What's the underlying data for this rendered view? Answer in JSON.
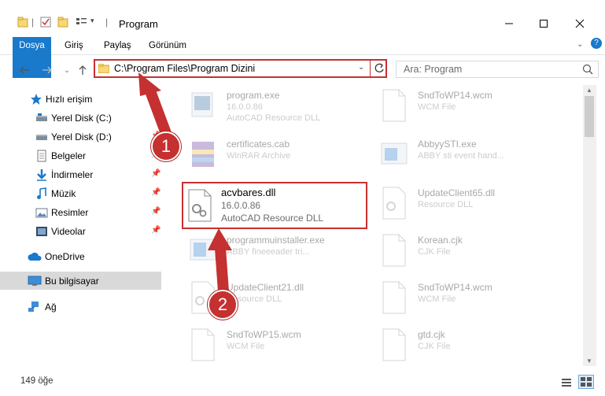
{
  "window": {
    "title": "Program",
    "minimize_icon": "minimize-icon",
    "maximize_icon": "maximize-icon",
    "close_icon": "close-icon"
  },
  "ribbon": {
    "tabs": [
      "Dosya",
      "Giriş",
      "Paylaş",
      "Görünüm"
    ]
  },
  "address": {
    "path": "C:\\Program Files\\Program Dizini"
  },
  "search": {
    "placeholder": "Ara: Program"
  },
  "sidebar": {
    "items": [
      {
        "label": "Hızlı erişim",
        "icon": "star-icon"
      },
      {
        "label": "Yerel Disk (C:)",
        "icon": "drive-icon"
      },
      {
        "label": "Yerel Disk (D:)",
        "icon": "drive-icon"
      },
      {
        "label": "Belgeler",
        "icon": "documents-icon"
      },
      {
        "label": "İndirmeler",
        "icon": "download-icon"
      },
      {
        "label": "Müzik",
        "icon": "music-icon"
      },
      {
        "label": "Resimler",
        "icon": "pictures-icon"
      },
      {
        "label": "Videolar",
        "icon": "video-icon"
      },
      {
        "label": "OneDrive",
        "icon": "cloud-icon"
      },
      {
        "label": "Bu bilgisayar",
        "icon": "computer-icon"
      },
      {
        "label": "Ağ",
        "icon": "network-icon"
      }
    ]
  },
  "files": [
    {
      "name": "program.exe",
      "line1": "16.0.0.86",
      "line2": "AutoCAD Resource DLL"
    },
    {
      "name": "SndToWP14.wcm",
      "line1": "WCM File",
      "line2": ""
    },
    {
      "name": "certificates.cab",
      "line1": "WinRAR Archive",
      "line2": ""
    },
    {
      "name": "AbbyySTI.exe",
      "line1": "ABBY sti event hand...",
      "line2": ""
    },
    {
      "name": "acvbares.dll",
      "line1": "16.0.0.86",
      "line2": "AutoCAD Resource DLL"
    },
    {
      "name": "UpdateClient65.dll",
      "line1": "Resource DLL",
      "line2": ""
    },
    {
      "name": "programmuinstaller.exe",
      "line1": "ABBY fineeeader tri...",
      "line2": ""
    },
    {
      "name": "Korean.cjk",
      "line1": "CJK File",
      "line2": ""
    },
    {
      "name": "UpdateClient21.dll",
      "line1": "Resource DLL",
      "line2": ""
    },
    {
      "name": "SndToWP14.wcm",
      "line1": "WCM File",
      "line2": ""
    },
    {
      "name": "SndToWP15.wcm",
      "line1": "WCM File",
      "line2": ""
    },
    {
      "name": "gtd.cjk",
      "line1": "CJK File",
      "line2": ""
    }
  ],
  "status": {
    "count": "149 öğe"
  },
  "callouts": [
    "1",
    "2"
  ],
  "colors": {
    "accent": "#1979ca",
    "highlight": "#c92f2f",
    "callout": "#c53030"
  }
}
